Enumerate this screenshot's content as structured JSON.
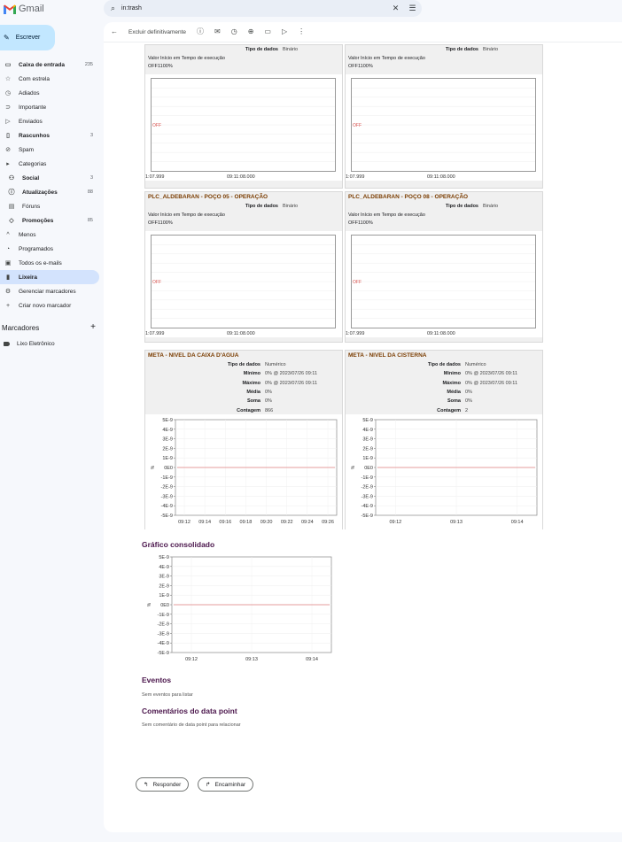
{
  "app": {
    "name": "Gmail"
  },
  "search": {
    "query": "in:trash"
  },
  "compose_label": "Escrever",
  "nav": [
    {
      "label": "Caixa de entrada",
      "count": "235",
      "icon": "inbox-icon",
      "glyph": "▭",
      "bold": true
    },
    {
      "label": "Com estrela",
      "count": "",
      "icon": "star-icon",
      "glyph": "☆",
      "bold": false
    },
    {
      "label": "Adiados",
      "count": "",
      "icon": "clock-icon",
      "glyph": "◷",
      "bold": false
    },
    {
      "label": "Importante",
      "count": "",
      "icon": "important-icon",
      "glyph": "⊃",
      "bold": false
    },
    {
      "label": "Enviados",
      "count": "",
      "icon": "send-icon",
      "glyph": "▷",
      "bold": false
    },
    {
      "label": "Rascunhos",
      "count": "3",
      "icon": "draft-icon",
      "glyph": "▯",
      "bold": true
    },
    {
      "label": "Spam",
      "count": "",
      "icon": "spam-icon",
      "glyph": "⊘",
      "bold": false
    },
    {
      "label": "Categorias",
      "count": "",
      "icon": "label-icon",
      "glyph": "▸",
      "bold": false
    },
    {
      "label": "Social",
      "count": "3",
      "icon": "people-icon",
      "glyph": "⚇",
      "bold": true,
      "sub": true
    },
    {
      "label": "Atualizações",
      "count": "88",
      "icon": "info-icon",
      "glyph": "ⓘ",
      "bold": true,
      "sub": true
    },
    {
      "label": "Fóruns",
      "count": "",
      "icon": "forum-icon",
      "glyph": "▤",
      "bold": false,
      "sub": true
    },
    {
      "label": "Promoções",
      "count": "85",
      "icon": "tag-icon",
      "glyph": "◇",
      "bold": true,
      "sub": true
    },
    {
      "label": "Menos",
      "count": "",
      "icon": "chevron-up-icon",
      "glyph": "^",
      "bold": false
    },
    {
      "label": "Programados",
      "count": "",
      "icon": "scheduled-icon",
      "glyph": "◔",
      "bold": false
    },
    {
      "label": "Todos os e-mails",
      "count": "",
      "icon": "all-mail-icon",
      "glyph": "▣",
      "bold": false
    },
    {
      "label": "Lixeira",
      "count": "",
      "icon": "trash-icon",
      "glyph": "▮",
      "bold": false,
      "active": true
    },
    {
      "label": "Gerenciar marcadores",
      "count": "",
      "icon": "gear-icon",
      "glyph": "⚙",
      "bold": false
    },
    {
      "label": "Criar novo marcador",
      "count": "",
      "icon": "plus-icon",
      "glyph": "+",
      "bold": false
    }
  ],
  "labels_section": {
    "title": "Marcadores",
    "items": [
      "Lixo Eletrônico"
    ]
  },
  "toolbar": {
    "delete_forever": "Excluir definitivamente"
  },
  "cards_top": [
    {
      "title": "",
      "tipo_label": "Tipo de dados",
      "tipo_value": "Binário",
      "table_header": "Valor Início em Tempo de execução",
      "row": [
        "OFF",
        "1",
        "100%"
      ],
      "off_label": "OFF",
      "ticks": [
        "1:07.999",
        "09:11:08.000"
      ]
    },
    {
      "title": "",
      "tipo_label": "Tipo de dados",
      "tipo_value": "Binário",
      "table_header": "Valor Início em Tempo de execução",
      "row": [
        "OFF",
        "1",
        "100%"
      ],
      "off_label": "OFF",
      "ticks": [
        "1:07.999",
        "09:11:08.000"
      ]
    }
  ],
  "cards_mid": [
    {
      "title": "PLC_ALDEBARAN - POÇO 05 - OPERAÇÃO",
      "tipo_label": "Tipo de dados",
      "tipo_value": "Binário",
      "table_header": "Valor Início em Tempo de execução",
      "row": [
        "OFF",
        "1",
        "100%"
      ],
      "off_label": "OFF",
      "ticks": [
        "1:07.999",
        "09:11:08.000"
      ]
    },
    {
      "title": "PLC_ALDEBARAN - POÇO 08 - OPERAÇÃO",
      "tipo_label": "Tipo de dados",
      "tipo_value": "Binário",
      "table_header": "Valor Início em Tempo de execução",
      "row": [
        "OFF",
        "1",
        "100%"
      ],
      "off_label": "OFF",
      "ticks": [
        "1:07.999",
        "09:11:08.000"
      ]
    }
  ],
  "cards_num": [
    {
      "title": "META - NIVEL DA CAIXA D'AGUA",
      "stats": [
        [
          "Tipo de dados",
          "Numérico"
        ],
        [
          "Mínimo",
          "0% @ 2023/07/26 09:11"
        ],
        [
          "Máximo",
          "0% @ 2023/07/26 09:11"
        ],
        [
          "Média",
          "0%"
        ],
        [
          "Soma",
          "0%"
        ],
        [
          "Contagem",
          "866"
        ]
      ]
    },
    {
      "title": "META - NIVEL DA CISTERNA",
      "stats": [
        [
          "Tipo de dados",
          "Numérico"
        ],
        [
          "Mínimo",
          "0% @ 2023/07/26 09:11"
        ],
        [
          "Máximo",
          "0% @ 2023/07/26 09:11"
        ],
        [
          "Média",
          "0%"
        ],
        [
          "Soma",
          "0%"
        ],
        [
          "Contagem",
          "2"
        ]
      ]
    }
  ],
  "consolidated": {
    "title": "Gráfico consolidado"
  },
  "events": {
    "title": "Eventos",
    "text": "Sem eventos para listar"
  },
  "comments": {
    "title": "Comentários do data point",
    "text": "Sem comentário de data point para relacionar"
  },
  "actions": {
    "reply": "Responder",
    "forward": "Encaminhar"
  },
  "chart_data": [
    {
      "type": "line",
      "title": "",
      "ylabel": "%",
      "yticks": [
        "5E-9",
        "4E-9",
        "3E-9",
        "2E-9",
        "1E-9",
        "0E0",
        "-1E-9",
        "-2E-9",
        "-3E-9",
        "-4E-9",
        "-5E-9"
      ],
      "x": [
        "09:12",
        "09:14",
        "09:16",
        "09:18",
        "09:20",
        "09:22",
        "09:24",
        "09:26"
      ],
      "ylim": [
        -5e-09,
        5e-09
      ],
      "series": [
        {
          "values": [
            0,
            0,
            0,
            0,
            0,
            0,
            0,
            0
          ]
        }
      ],
      "color": "#e08080"
    },
    {
      "type": "line",
      "title": "",
      "ylabel": "%",
      "yticks": [
        "5E-9",
        "4E-9",
        "3E-9",
        "2E-9",
        "1E-9",
        "0E0",
        "-1E-9",
        "-2E-9",
        "-3E-9",
        "-4E-9",
        "-5E-9"
      ],
      "x": [
        "09:12",
        "09:13",
        "09:14"
      ],
      "ylim": [
        -5e-09,
        5e-09
      ],
      "series": [
        {
          "values": [
            0,
            0,
            0
          ]
        }
      ],
      "color": "#e08080"
    },
    {
      "type": "line",
      "title": "",
      "ylabel": "%",
      "yticks": [
        "5E-9",
        "4E-9",
        "3E-9",
        "2E-9",
        "1E-9",
        "0E0",
        "-1E-9",
        "-2E-9",
        "-3E-9",
        "-4E-9",
        "-5E-9"
      ],
      "x": [
        "09:12",
        "09:13",
        "09:14"
      ],
      "ylim": [
        -5e-09,
        5e-09
      ],
      "series": [
        {
          "values": [
            0,
            0,
            0
          ]
        }
      ],
      "color": "#e08080"
    }
  ]
}
